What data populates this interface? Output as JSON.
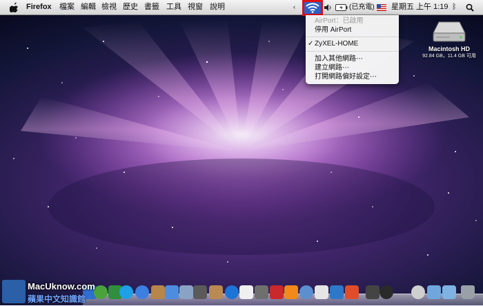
{
  "menubar": {
    "app_name": "Firefox",
    "menus": [
      "檔案",
      "編輯",
      "檢視",
      "歷史",
      "書籤",
      "工具",
      "視窗",
      "說明"
    ],
    "battery_status": "(已充電)",
    "clock": "星期五 上午 1:19"
  },
  "wifi_menu": {
    "status": "AirPort：已啟用",
    "toggle": "停用 AirPort",
    "networks": [
      {
        "name": "ZyXEL-HOME",
        "checked": true,
        "check": "✓"
      }
    ],
    "join_other": "加入其他網路⋯",
    "create": "建立網路⋯",
    "open_prefs": "打開網路偏好設定⋯"
  },
  "desktop": {
    "drive_name": "Macintosh HD",
    "drive_info": "92.84 GB，11.4 GB 可用"
  },
  "watermark": {
    "site": "MacUknow.com",
    "tagline": "蘋果中文知識館"
  },
  "dock": {
    "icons": [
      "finder-icon",
      "network-icon",
      "safari-icon",
      "user-icon",
      "skype-icon",
      "ichat-icon",
      "preview-icon",
      "itunes-icon",
      "iphoto-icon",
      "timemachine-icon",
      "calendar-icon",
      "dashboard-icon",
      "photobooth-icon",
      "vlc-icon",
      "activity-icon",
      "textedit-icon",
      "terminal-icon",
      "parallels-icon",
      "spaces-icon",
      "mail-icon",
      "trash-icon",
      "folder-icon",
      "downloads-icon",
      "documents-icon"
    ]
  }
}
